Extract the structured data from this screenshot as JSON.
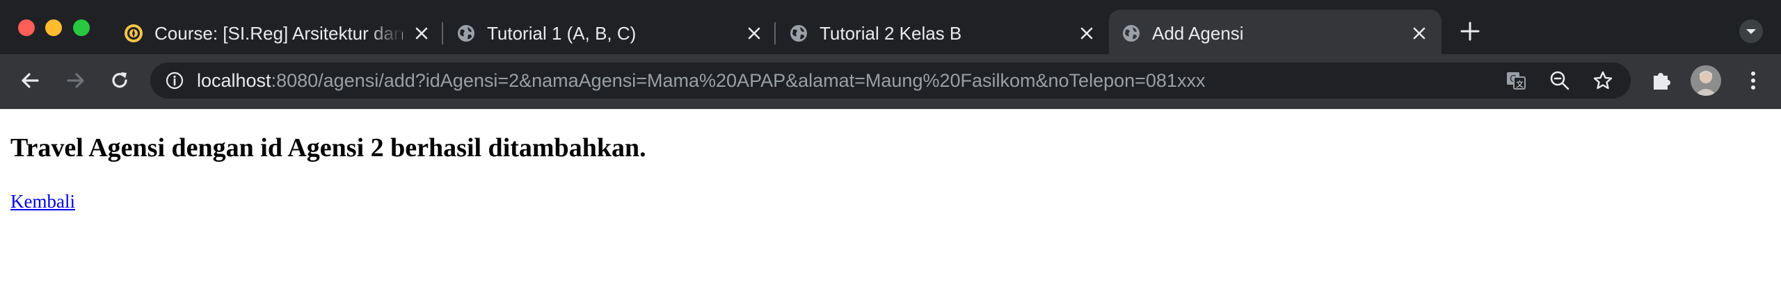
{
  "browser": {
    "tabs": [
      {
        "title": "Course: [SI.Reg] Arsitektur dan Pemrograman Aplikasi Perusahaan",
        "favicon": "university-seal-icon",
        "active": false
      },
      {
        "title": "Tutorial 1 (A, B, C)",
        "favicon": "globe-icon",
        "active": false
      },
      {
        "title": "Tutorial 2 Kelas B",
        "favicon": "globe-icon",
        "active": false
      },
      {
        "title": "Add Agensi",
        "favicon": "globe-icon",
        "active": true
      }
    ],
    "address_bar": {
      "host": "localhost",
      "rest": ":8080/agensi/add?idAgensi=2&namaAgensi=Mama%20APAP&alamat=Maung%20Fasilkom&noTelepon=081xxx"
    },
    "colors": {
      "frame": "#202124",
      "toolbar": "#35363a",
      "text": "#e8eaed",
      "muted": "#9aa0a6",
      "link": "#0000ee"
    }
  },
  "page": {
    "heading": "Travel Agensi dengan id Agensi 2 berhasil ditambahkan.",
    "back_link": "Kembali"
  }
}
